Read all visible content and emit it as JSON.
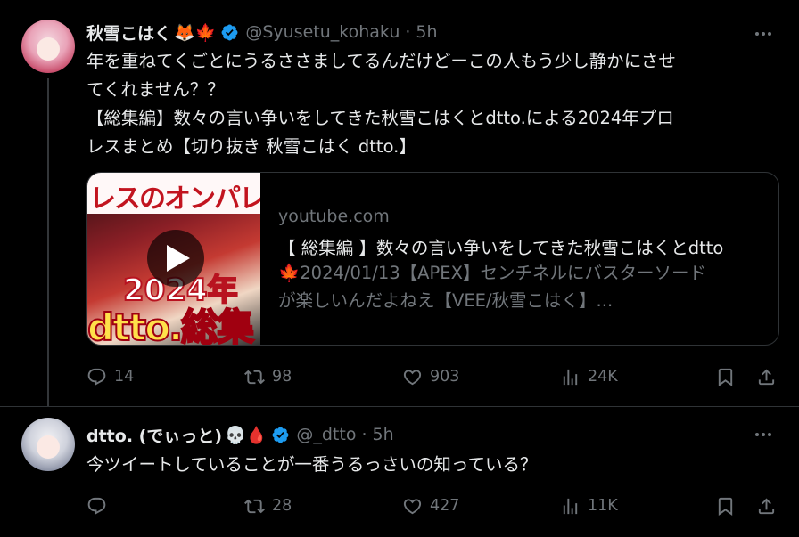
{
  "tweets": [
    {
      "display_name": "秋雪こはく",
      "name_emojis": "🦊🍁",
      "handle": "@Syusetu_kohaku",
      "time": "5h",
      "text": "年を重ねてくごとにうるささましてるんだけどーこの人もう少し静かにさせ\nてくれません？？\n【総集編】数々の言い争いをしてきた秋雪こはくとdtto.による2024年プロ\nレスまとめ【切り抜き 秋雪こはく dtto.】",
      "card": {
        "thumbnail_band_text": "レスのオンパレ",
        "thumbnail_year_text": "2024年",
        "thumbnail_big_text": "dtto.総集",
        "domain": "youtube.com",
        "title": "【 総集編 】数々の言い争いをしてきた秋雪こはくとdtto",
        "description": "🍁2024/01/13【APEX】センチネルにバスターソード\nが楽しいんだよねえ【VEE/秋雪こはく】..."
      },
      "stats": {
        "replies": "14",
        "retweets": "98",
        "likes": "903",
        "views": "24K"
      }
    },
    {
      "display_name": "dtto. (でぃっと)",
      "name_emojis": "💀🩸",
      "handle": "@_dtto",
      "time": "5h",
      "text": "今ツイートしていることが一番うるっさいの知っている？",
      "stats": {
        "replies": "",
        "retweets": "28",
        "likes": "427",
        "views": "11K"
      }
    }
  ],
  "separator": "·",
  "colors": {
    "background": "#000000",
    "text": "#e7e9ea",
    "muted": "#71767b",
    "verified": "#1d9bf0",
    "border": "#2f3336"
  },
  "icons": [
    "reply-icon",
    "retweet-icon",
    "like-icon",
    "views-icon",
    "bookmark-icon",
    "share-icon",
    "more-icon",
    "verified-badge-icon",
    "play-icon"
  ]
}
